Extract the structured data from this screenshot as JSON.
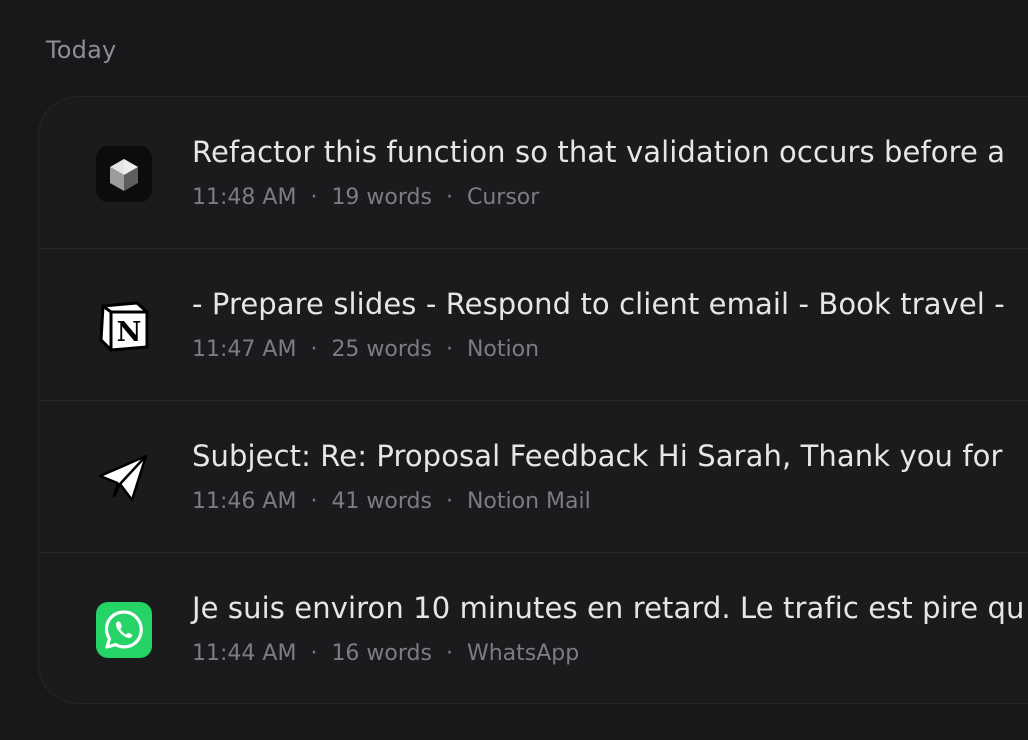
{
  "section": {
    "label": "Today"
  },
  "entries": [
    {
      "text": "Refactor this function so that validation occurs before a",
      "time": "11:48 AM",
      "words": "19 words",
      "app": "Cursor",
      "icon": "cursor-app-icon"
    },
    {
      "text": "- Prepare slides - Respond to client email - Book travel -",
      "time": "11:47 AM",
      "words": "25 words",
      "app": "Notion",
      "icon": "notion-app-icon"
    },
    {
      "text": "Subject: Re: Proposal Feedback Hi Sarah, Thank you for",
      "time": "11:46 AM",
      "words": "41 words",
      "app": "Notion Mail",
      "icon": "notion-mail-app-icon"
    },
    {
      "text": "Je suis environ 10 minutes en retard. Le trafic est pire qu",
      "time": "11:44 AM",
      "words": "16 words",
      "app": "WhatsApp",
      "icon": "whatsapp-app-icon"
    }
  ],
  "separator": "·",
  "colors": {
    "background": "#18181a",
    "card": "#1b1b1d",
    "primary_text": "#e6e6e8",
    "secondary_text": "#7c7c82",
    "whatsapp_green": "#25d366"
  }
}
